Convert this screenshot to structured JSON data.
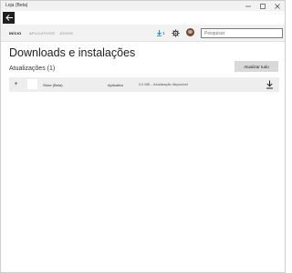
{
  "window": {
    "title": "Loja (Beta)",
    "controls": [
      "minimize",
      "maximize",
      "close"
    ]
  },
  "nav": {
    "tabs": [
      {
        "label": "INÍCIO",
        "active": true
      },
      {
        "label": "APLICATIVOS",
        "active": false
      },
      {
        "label": "JOGOS",
        "active": false
      }
    ],
    "download_count": "1",
    "search_placeholder": "Pesquisar"
  },
  "main": {
    "title": "Downloads e instalações",
    "updates_label": "Atualizações (1)",
    "update_all_label": "Atualizar tudo",
    "items": [
      {
        "expand_symbol": "+",
        "name": "Store (Beta)",
        "type": "Aplicativo",
        "status": "0,0 MB – Atualização disponível"
      }
    ]
  },
  "icons": {
    "back": "arrow-left-icon",
    "download": "download-icon",
    "settings": "gear-icon",
    "avatar": "user-avatar"
  },
  "colors": {
    "titlebar_bg": "#f2f2f2",
    "back_button_bg": "#1f1f1f",
    "row_bg": "#eeeeee",
    "button_bg": "#d9d9d9",
    "download_accent": "#1c7ad1"
  }
}
